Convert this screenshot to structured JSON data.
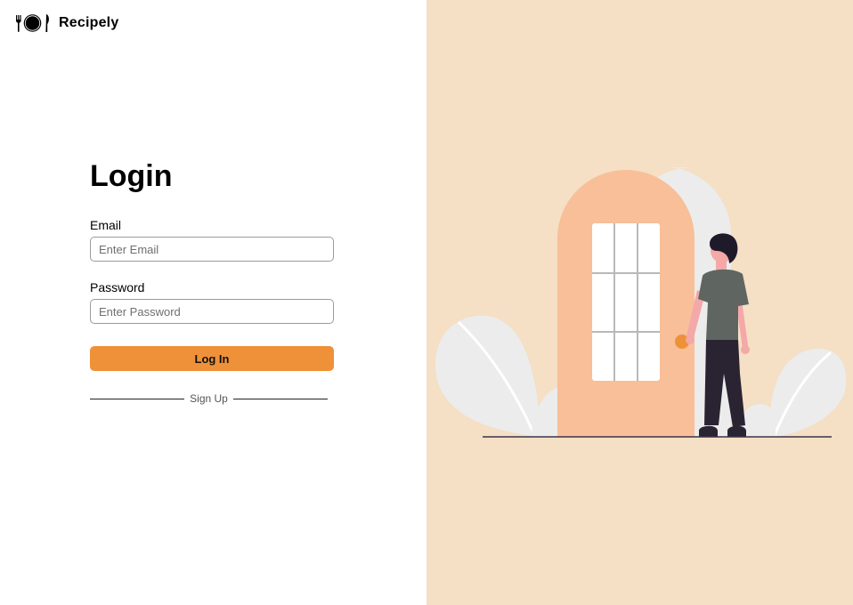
{
  "brand": {
    "name": "Recipely",
    "icon": "plate-fork-knife-icon"
  },
  "login": {
    "title": "Login",
    "email_label": "Email",
    "email_placeholder": "Enter Email",
    "email_value": "",
    "password_label": "Password",
    "password_placeholder": "Enter Password",
    "password_value": "",
    "submit_label": "Log In",
    "signup_label": "Sign Up"
  },
  "colors": {
    "accent": "#ef9139",
    "illustration_bg": "#f5dfc5",
    "door": "#f8bf98",
    "leaf": "#ececec",
    "shirt": "#5f6661",
    "pants": "#2a2432"
  }
}
